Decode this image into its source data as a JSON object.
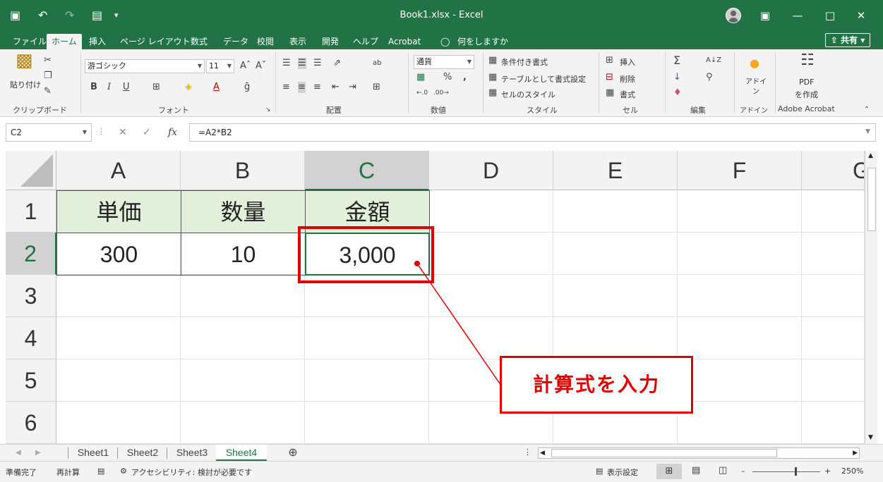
{
  "titlebar": {
    "title": "Book1.xlsx  -  Excel",
    "quick_access": [
      "save-icon",
      "undo-icon",
      "redo-icon",
      "print-preview-icon",
      "customize-icon"
    ],
    "window_buttons": [
      "ribbon-display-icon",
      "minimize-icon",
      "maximize-icon",
      "close-icon"
    ]
  },
  "tabs": [
    "ファイル",
    "ホーム",
    "挿入",
    "ページ レイアウト",
    "数式",
    "データ",
    "校閲",
    "表示",
    "開発",
    "ヘルプ",
    "Acrobat",
    "何をしますか"
  ],
  "active_tab": "ホーム",
  "share_label": "共有",
  "ribbon": {
    "clipboard": {
      "paste_label": "貼り付け",
      "group_label": "クリップボード"
    },
    "font": {
      "font_name": "游ゴシック",
      "font_size": "11",
      "bold": "B",
      "italic": "I",
      "underline": "U",
      "font_color_mark": "A",
      "group_label": "フォント"
    },
    "alignment": {
      "group_label": "配置"
    },
    "number": {
      "format": "通貨",
      "percent": "%",
      "comma": ",",
      "group_label": "数値"
    },
    "styles": {
      "conditional": "条件付き書式",
      "table": "テーブルとして書式設定",
      "cell_styles": "セルのスタイル",
      "group_label": "スタイル"
    },
    "cells": {
      "insert": "挿入",
      "delete": "削除",
      "format": "書式",
      "group_label": "セル"
    },
    "editing": {
      "group_label": "編集"
    },
    "addins": {
      "label": "アドイン",
      "group_label": "アドイン"
    },
    "acrobat": {
      "pdf": "PDF",
      "create": "を作成",
      "group_label": "Adobe Acrobat"
    }
  },
  "formula_bar": {
    "name_box": "C2",
    "formula": "=A2*B2"
  },
  "grid": {
    "columns": [
      "A",
      "B",
      "C",
      "D",
      "E",
      "F",
      "G"
    ],
    "rows": [
      "1",
      "2",
      "3",
      "4",
      "5",
      "6"
    ],
    "selected_cell": "C2",
    "header_cells": [
      "単価",
      "数量",
      "金額"
    ],
    "values": [
      "300",
      "10",
      "3,000"
    ]
  },
  "sheets": [
    "Sheet1",
    "Sheet2",
    "Sheet3",
    "Sheet4"
  ],
  "active_sheet": "Sheet4",
  "statusbar": {
    "ready": "準備完了",
    "recalc": "再計算",
    "accessibility": "アクセシビリティ: 検討が必要です",
    "display_settings": "表示設定",
    "zoom": "250%"
  },
  "annotation": {
    "callout_text": "計算式を入力",
    "highlight_color": "#e00000"
  },
  "colors": {
    "excel_green": "#217346",
    "header_fill": "#e2efda"
  }
}
